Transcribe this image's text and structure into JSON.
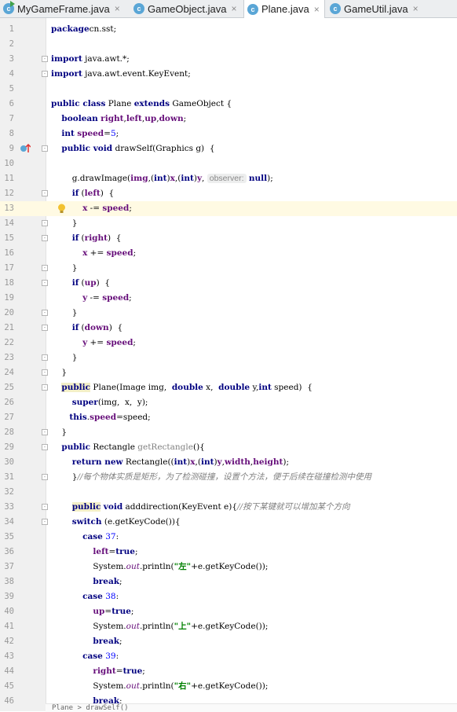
{
  "tabs": [
    {
      "label": "MyGameFrame.java",
      "active": false,
      "icon": "java-main-class-icon"
    },
    {
      "label": "GameObject.java",
      "active": false,
      "icon": "java-class-icon"
    },
    {
      "label": "Plane.java",
      "active": true,
      "icon": "java-class-icon"
    },
    {
      "label": "GameUtil.java",
      "active": false,
      "icon": "java-class-icon"
    }
  ],
  "icon_letter": "c",
  "close_glyph": "×",
  "current_line": 13,
  "gutter_markers": {
    "9": "override-up-arrow-icon",
    "13": "intention-bulb-icon"
  },
  "lines": [
    {
      "n": "1",
      "tokens": [
        [
          "kw",
          "package"
        ],
        [
          "",
          "cn.sst;"
        ]
      ]
    },
    {
      "n": "2",
      "tokens": []
    },
    {
      "n": "3",
      "tokens": [
        [
          "kw",
          "import"
        ],
        [
          "",
          " java.awt.*;"
        ]
      ]
    },
    {
      "n": "4",
      "tokens": [
        [
          "kw",
          "import"
        ],
        [
          "",
          " java.awt.event.KeyEvent;"
        ]
      ]
    },
    {
      "n": "5",
      "tokens": []
    },
    {
      "n": "6",
      "tokens": [
        [
          "kw",
          "public class"
        ],
        [
          "",
          " Plane "
        ],
        [
          "kw",
          "extends"
        ],
        [
          "",
          " GameObject {"
        ]
      ]
    },
    {
      "n": "7",
      "tokens": [
        [
          "",
          "    "
        ],
        [
          "kw",
          "boolean"
        ],
        [
          "",
          " "
        ],
        [
          "fld",
          "right"
        ],
        [
          "",
          ","
        ],
        [
          "fld",
          "left"
        ],
        [
          "",
          ","
        ],
        [
          "fld",
          "up"
        ],
        [
          "",
          ","
        ],
        [
          "fld",
          "down"
        ],
        [
          "",
          ";"
        ]
      ]
    },
    {
      "n": "8",
      "tokens": [
        [
          "",
          "    "
        ],
        [
          "kw",
          "int"
        ],
        [
          "",
          " "
        ],
        [
          "fld",
          "speed"
        ],
        [
          "",
          "="
        ],
        [
          "num",
          "5"
        ],
        [
          "",
          ";"
        ]
      ]
    },
    {
      "n": "9",
      "tokens": [
        [
          "",
          "    "
        ],
        [
          "kw",
          "public void"
        ],
        [
          "",
          " drawSelf(Graphics g)  {"
        ]
      ]
    },
    {
      "n": "10",
      "tokens": []
    },
    {
      "n": "11",
      "tokens": [
        [
          "",
          "        g.drawImage("
        ],
        [
          "fld",
          "img"
        ],
        [
          "",
          ",("
        ],
        [
          "kw",
          "int"
        ],
        [
          "",
          ")"
        ],
        [
          "fld",
          "x"
        ],
        [
          "",
          ",("
        ],
        [
          "kw",
          "int"
        ],
        [
          "",
          ")"
        ],
        [
          "fld",
          "y"
        ],
        [
          "",
          ", "
        ],
        [
          "hint",
          "observer:"
        ],
        [
          "",
          " "
        ],
        [
          "kw",
          "null"
        ],
        [
          "",
          ");"
        ]
      ]
    },
    {
      "n": "12",
      "tokens": [
        [
          "",
          "        "
        ],
        [
          "kw",
          "if"
        ],
        [
          "",
          " ("
        ],
        [
          "fld",
          "left"
        ],
        [
          "",
          ")  {"
        ]
      ]
    },
    {
      "n": "13",
      "tokens": [
        [
          "",
          "            "
        ],
        [
          "fld",
          "x"
        ],
        [
          "",
          " -= "
        ],
        [
          "fld",
          "speed"
        ],
        [
          "",
          ";"
        ]
      ]
    },
    {
      "n": "14",
      "tokens": [
        [
          "",
          "        }"
        ]
      ]
    },
    {
      "n": "15",
      "tokens": [
        [
          "",
          "        "
        ],
        [
          "kw",
          "if"
        ],
        [
          "",
          " ("
        ],
        [
          "fld",
          "right"
        ],
        [
          "",
          ")  {"
        ]
      ]
    },
    {
      "n": "16",
      "tokens": [
        [
          "",
          "            "
        ],
        [
          "fld",
          "x"
        ],
        [
          "",
          " += "
        ],
        [
          "fld",
          "speed"
        ],
        [
          "",
          ";"
        ]
      ]
    },
    {
      "n": "17",
      "tokens": [
        [
          "",
          "        }"
        ]
      ]
    },
    {
      "n": "18",
      "tokens": [
        [
          "",
          "        "
        ],
        [
          "kw",
          "if"
        ],
        [
          "",
          " ("
        ],
        [
          "fld",
          "up"
        ],
        [
          "",
          ")  {"
        ]
      ]
    },
    {
      "n": "19",
      "tokens": [
        [
          "",
          "            "
        ],
        [
          "fld",
          "y"
        ],
        [
          "",
          " -= "
        ],
        [
          "fld",
          "speed"
        ],
        [
          "",
          ";"
        ]
      ]
    },
    {
      "n": "20",
      "tokens": [
        [
          "",
          "        }"
        ]
      ]
    },
    {
      "n": "21",
      "tokens": [
        [
          "",
          "        "
        ],
        [
          "kw",
          "if"
        ],
        [
          "",
          " ("
        ],
        [
          "fld",
          "down"
        ],
        [
          "",
          ")  {"
        ]
      ]
    },
    {
      "n": "22",
      "tokens": [
        [
          "",
          "            "
        ],
        [
          "fld",
          "y"
        ],
        [
          "",
          " += "
        ],
        [
          "fld",
          "speed"
        ],
        [
          "",
          ";"
        ]
      ]
    },
    {
      "n": "23",
      "tokens": [
        [
          "",
          "        }"
        ]
      ]
    },
    {
      "n": "24",
      "tokens": [
        [
          "",
          "    }"
        ]
      ]
    },
    {
      "n": "25",
      "tokens": [
        [
          "",
          "    "
        ],
        [
          "kwhl",
          "public"
        ],
        [
          "",
          " Plane(Image img,  "
        ],
        [
          "kw",
          "double"
        ],
        [
          "",
          " x,  "
        ],
        [
          "kw",
          "double"
        ],
        [
          "",
          " y,"
        ],
        [
          "kw",
          "int"
        ],
        [
          "",
          " speed)  {"
        ]
      ]
    },
    {
      "n": "26",
      "tokens": [
        [
          "",
          "        "
        ],
        [
          "kw",
          "super"
        ],
        [
          "",
          "(img,  x,  y);"
        ]
      ]
    },
    {
      "n": "27",
      "tokens": [
        [
          "",
          "       "
        ],
        [
          "kw",
          "this"
        ],
        [
          "",
          "."
        ],
        [
          "fld",
          "speed"
        ],
        [
          "",
          "=speed;"
        ]
      ]
    },
    {
      "n": "28",
      "tokens": [
        [
          "",
          "    }"
        ]
      ]
    },
    {
      "n": "29",
      "tokens": [
        [
          "",
          "    "
        ],
        [
          "kw",
          "public"
        ],
        [
          "",
          " Rectangle "
        ],
        [
          "dim",
          "getRectangle"
        ],
        [
          "",
          "(){"
        ]
      ]
    },
    {
      "n": "30",
      "tokens": [
        [
          "",
          "        "
        ],
        [
          "kw",
          "return new"
        ],
        [
          "",
          " Rectangle(("
        ],
        [
          "kw",
          "int"
        ],
        [
          "",
          ")"
        ],
        [
          "fld",
          "x"
        ],
        [
          "",
          ",("
        ],
        [
          "kw",
          "int"
        ],
        [
          "",
          ")"
        ],
        [
          "fld",
          "y"
        ],
        [
          "",
          ","
        ],
        [
          "fld",
          "width"
        ],
        [
          "",
          ","
        ],
        [
          "fld",
          "height"
        ],
        [
          "",
          ");"
        ]
      ]
    },
    {
      "n": "31",
      "tokens": [
        [
          "",
          "        }"
        ],
        [
          "cmt",
          "//每个物体实质是矩形，为了检测碰撞，设置个方法，便于后续在碰撞检测中使用"
        ]
      ]
    },
    {
      "n": "32",
      "tokens": []
    },
    {
      "n": "33",
      "tokens": [
        [
          "",
          "        "
        ],
        [
          "kwhl",
          "public"
        ],
        [
          "",
          " "
        ],
        [
          "kw",
          "void"
        ],
        [
          "",
          " adddirection(KeyEvent e){"
        ],
        [
          "cmt",
          "//按下某键就可以增加某个方向"
        ]
      ]
    },
    {
      "n": "34",
      "tokens": [
        [
          "",
          "        "
        ],
        [
          "kw",
          "switch"
        ],
        [
          "",
          " (e.getKeyCode()){"
        ]
      ]
    },
    {
      "n": "35",
      "tokens": [
        [
          "",
          "            "
        ],
        [
          "kw",
          "case"
        ],
        [
          "",
          " "
        ],
        [
          "num",
          "37"
        ],
        [
          "",
          ":"
        ]
      ]
    },
    {
      "n": "36",
      "tokens": [
        [
          "",
          "                "
        ],
        [
          "fld",
          "left"
        ],
        [
          "",
          "="
        ],
        [
          "kw",
          "true"
        ],
        [
          "",
          ";"
        ]
      ]
    },
    {
      "n": "37",
      "tokens": [
        [
          "",
          "                System."
        ],
        [
          "stat",
          "out"
        ],
        [
          "",
          ".println("
        ],
        [
          "str",
          "\"左\""
        ],
        [
          "",
          "+e.getKeyCode());"
        ]
      ]
    },
    {
      "n": "38",
      "tokens": [
        [
          "",
          "                "
        ],
        [
          "kw",
          "break"
        ],
        [
          "",
          ";"
        ]
      ]
    },
    {
      "n": "39",
      "tokens": [
        [
          "",
          "            "
        ],
        [
          "kw",
          "case"
        ],
        [
          "",
          " "
        ],
        [
          "num",
          "38"
        ],
        [
          "",
          ":"
        ]
      ]
    },
    {
      "n": "40",
      "tokens": [
        [
          "",
          "                "
        ],
        [
          "fld",
          "up"
        ],
        [
          "",
          "="
        ],
        [
          "kw",
          "true"
        ],
        [
          "",
          ";"
        ]
      ]
    },
    {
      "n": "41",
      "tokens": [
        [
          "",
          "                System."
        ],
        [
          "stat",
          "out"
        ],
        [
          "",
          ".println("
        ],
        [
          "str",
          "\"上\""
        ],
        [
          "",
          "+e.getKeyCode());"
        ]
      ]
    },
    {
      "n": "42",
      "tokens": [
        [
          "",
          "                "
        ],
        [
          "kw",
          "break"
        ],
        [
          "",
          ";"
        ]
      ]
    },
    {
      "n": "43",
      "tokens": [
        [
          "",
          "            "
        ],
        [
          "kw",
          "case"
        ],
        [
          "",
          " "
        ],
        [
          "num",
          "39"
        ],
        [
          "",
          ":"
        ]
      ]
    },
    {
      "n": "44",
      "tokens": [
        [
          "",
          "                "
        ],
        [
          "fld",
          "right"
        ],
        [
          "",
          "="
        ],
        [
          "kw",
          "true"
        ],
        [
          "",
          ";"
        ]
      ]
    },
    {
      "n": "45",
      "tokens": [
        [
          "",
          "                System."
        ],
        [
          "stat",
          "out"
        ],
        [
          "",
          ".println("
        ],
        [
          "str",
          "\"右\""
        ],
        [
          "",
          "+e.getKeyCode());"
        ]
      ]
    },
    {
      "n": "46",
      "tokens": [
        [
          "",
          "                "
        ],
        [
          "kw",
          "break"
        ],
        [
          "",
          ";"
        ]
      ]
    }
  ],
  "fold_lines": [
    "3",
    "4",
    "9",
    "12",
    "14",
    "15",
    "17",
    "18",
    "20",
    "21",
    "23",
    "24",
    "25",
    "28",
    "29",
    "31",
    "33",
    "34"
  ],
  "breadcrumb": "Plane > drawSelf()"
}
